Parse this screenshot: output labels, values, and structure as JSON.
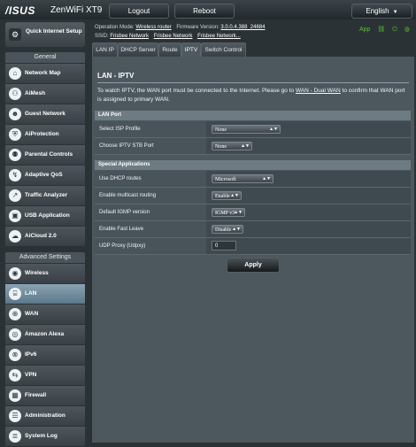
{
  "header": {
    "brand": "/ISUS",
    "model": "ZenWiFi XT9",
    "logout_label": "Logout",
    "reboot_label": "Reboot",
    "language": "English"
  },
  "status": {
    "operation_mode_label": "Operation Mode:",
    "operation_mode_value": "Wireless router",
    "firmware_label": "Firmware Version:",
    "firmware_value": "3.0.0.4.388_24684",
    "ssid_label": "SSID:",
    "ssids": [
      "Frisbee Network",
      "Frisbee Network",
      "Frisbee Network..."
    ],
    "icons": [
      "app-icon",
      "link-icon",
      "usb-icon",
      "wifi-icon",
      "person-icon"
    ],
    "app_label": "App",
    "accent_color": "#53c22b"
  },
  "sidebar": {
    "qis_label": "Quick Internet Setup",
    "general_header": "General",
    "general_items": [
      {
        "label": "Network Map",
        "icon": "network-map-icon"
      },
      {
        "label": "AiMesh",
        "icon": "aimesh-icon"
      },
      {
        "label": "Guest Network",
        "icon": "guest-network-icon"
      },
      {
        "label": "AiProtection",
        "icon": "aiprotection-icon"
      },
      {
        "label": "Parental Controls",
        "icon": "parental-controls-icon"
      },
      {
        "label": "Adaptive QoS",
        "icon": "adaptive-qos-icon"
      },
      {
        "label": "Traffic Analyzer",
        "icon": "traffic-analyzer-icon"
      },
      {
        "label": "USB Application",
        "icon": "usb-application-icon"
      },
      {
        "label": "AiCloud 2.0",
        "icon": "aicloud-icon"
      }
    ],
    "advanced_header": "Advanced Settings",
    "advanced_items": [
      {
        "label": "Wireless",
        "icon": "wireless-icon"
      },
      {
        "label": "LAN",
        "icon": "lan-icon",
        "active": true
      },
      {
        "label": "WAN",
        "icon": "wan-icon"
      },
      {
        "label": "Amazon Alexa",
        "icon": "amazon-alexa-icon"
      },
      {
        "label": "IPv6",
        "icon": "ipv6-icon"
      },
      {
        "label": "VPN",
        "icon": "vpn-icon"
      },
      {
        "label": "Firewall",
        "icon": "firewall-icon"
      },
      {
        "label": "Administration",
        "icon": "administration-icon"
      },
      {
        "label": "System Log",
        "icon": "system-log-icon"
      }
    ]
  },
  "tabs": [
    {
      "label": "LAN IP"
    },
    {
      "label": "DHCP Server"
    },
    {
      "label": "Route"
    },
    {
      "label": "IPTV",
      "active": true
    },
    {
      "label": "Switch Control"
    }
  ],
  "main": {
    "title": "LAN - IPTV",
    "desc_part1": "To watch IPTV, the WAN port must be connected to the Internet. Please go to ",
    "desc_link": "WAN - Dual WAN",
    "desc_part2": " to confirm that WAN port is assigned to primary WAN.",
    "lan_port_header": "LAN Port",
    "lan_port_rows": [
      {
        "label": "Select ISP Profile",
        "value": "None"
      },
      {
        "label": "Choose IPTV STB Port",
        "value": "None"
      }
    ],
    "special_header": "Special Applications",
    "special_rows": [
      {
        "label": "Use DHCP routes",
        "value": "Microsoft"
      },
      {
        "label": "Enable multicast routing",
        "value": "Enable"
      },
      {
        "label": "Default IGMP version",
        "value": "IGMP v3"
      },
      {
        "label": "Enable Fast Leave",
        "value": "Disable"
      },
      {
        "label": "UDP Proxy (Udpxy)",
        "value": "0"
      }
    ],
    "apply_label": "Apply"
  }
}
